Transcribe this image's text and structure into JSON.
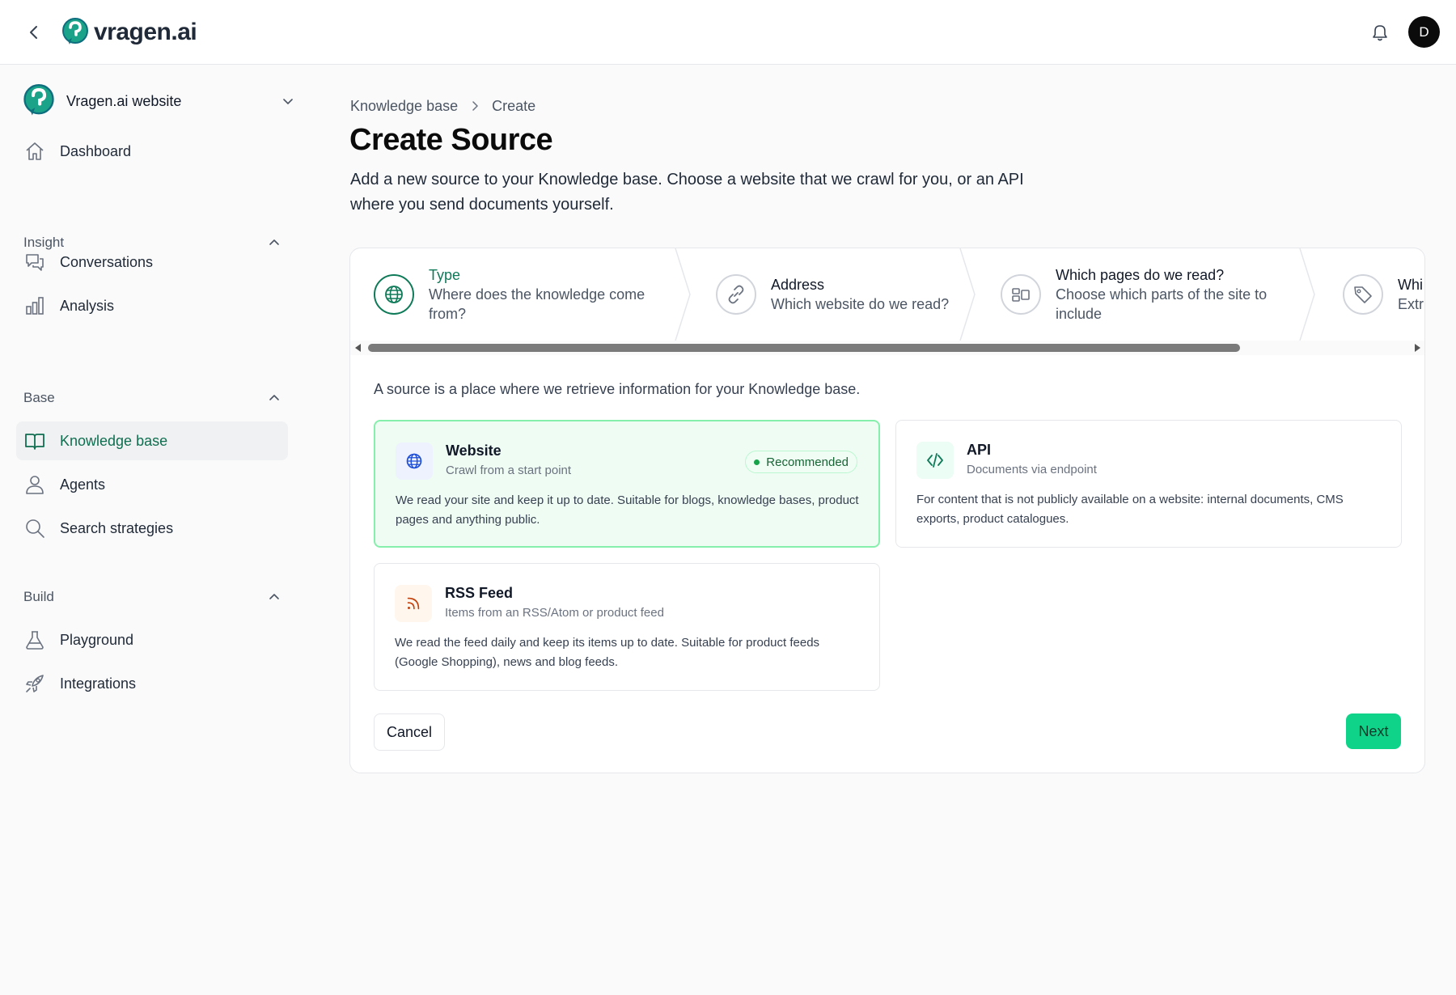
{
  "app": {
    "logo_text": "vragen.ai",
    "user_initial": "D"
  },
  "sidebar": {
    "workspace": "Vragen.ai website",
    "dashboard": "Dashboard",
    "sections": [
      {
        "label": "Insight",
        "items": [
          "Conversations",
          "Analysis"
        ]
      },
      {
        "label": "Base",
        "items": [
          "Knowledge base",
          "Agents",
          "Search strategies"
        ]
      },
      {
        "label": "Build",
        "items": [
          "Playground",
          "Integrations"
        ]
      }
    ],
    "active_item": "Knowledge base"
  },
  "breadcrumb": [
    "Knowledge base",
    "Create"
  ],
  "page": {
    "title": "Create Source",
    "description": "Add a new source to your Knowledge base. Choose a website that we crawl for you, or an API where you send documents yourself."
  },
  "steps": [
    {
      "title": "Type",
      "subtitle_lines": [
        "Where does the knowledge come",
        "from?"
      ],
      "active": true,
      "icon": "globe-icon"
    },
    {
      "title": "Address",
      "subtitle_lines": [
        "Which website do we read?"
      ],
      "active": false,
      "icon": "link-icon"
    },
    {
      "title": "Which pages do we read?",
      "subtitle_lines": [
        "Choose which parts of the site to",
        "include"
      ],
      "active": false,
      "icon": "layout-icon"
    },
    {
      "title": "Whi",
      "subtitle_lines": [
        "Extr"
      ],
      "active": false,
      "icon": "tag-icon"
    }
  ],
  "intro": "A source is a place where we retrieve information for your Knowledge base.",
  "cards": [
    {
      "title": "Website",
      "subtitle": "Crawl from a start point",
      "description": "We read your site and keep it up to date. Suitable for blogs, knowledge bases, product pages and anything public.",
      "badge": "Recommended",
      "selected": true,
      "icon": "globe-icon"
    },
    {
      "title": "API",
      "subtitle": "Documents via endpoint",
      "description": "For content that is not publicly available on a website: internal documents, CMS exports, product catalogues.",
      "selected": false,
      "icon": "code-icon"
    },
    {
      "title": "RSS Feed",
      "subtitle": "Items from an RSS/Atom or product feed",
      "description": "We read the feed daily and keep its items up to date. Suitable for product feeds (Google Shopping), news and blog feeds.",
      "selected": false,
      "icon": "rss-icon"
    }
  ],
  "actions": {
    "cancel": "Cancel",
    "next": "Next"
  },
  "colors": {
    "accent": "#0f7a58",
    "next_button": "#10d38a",
    "selected_card_bg": "#effcf4",
    "selected_card_border": "#86efac"
  }
}
